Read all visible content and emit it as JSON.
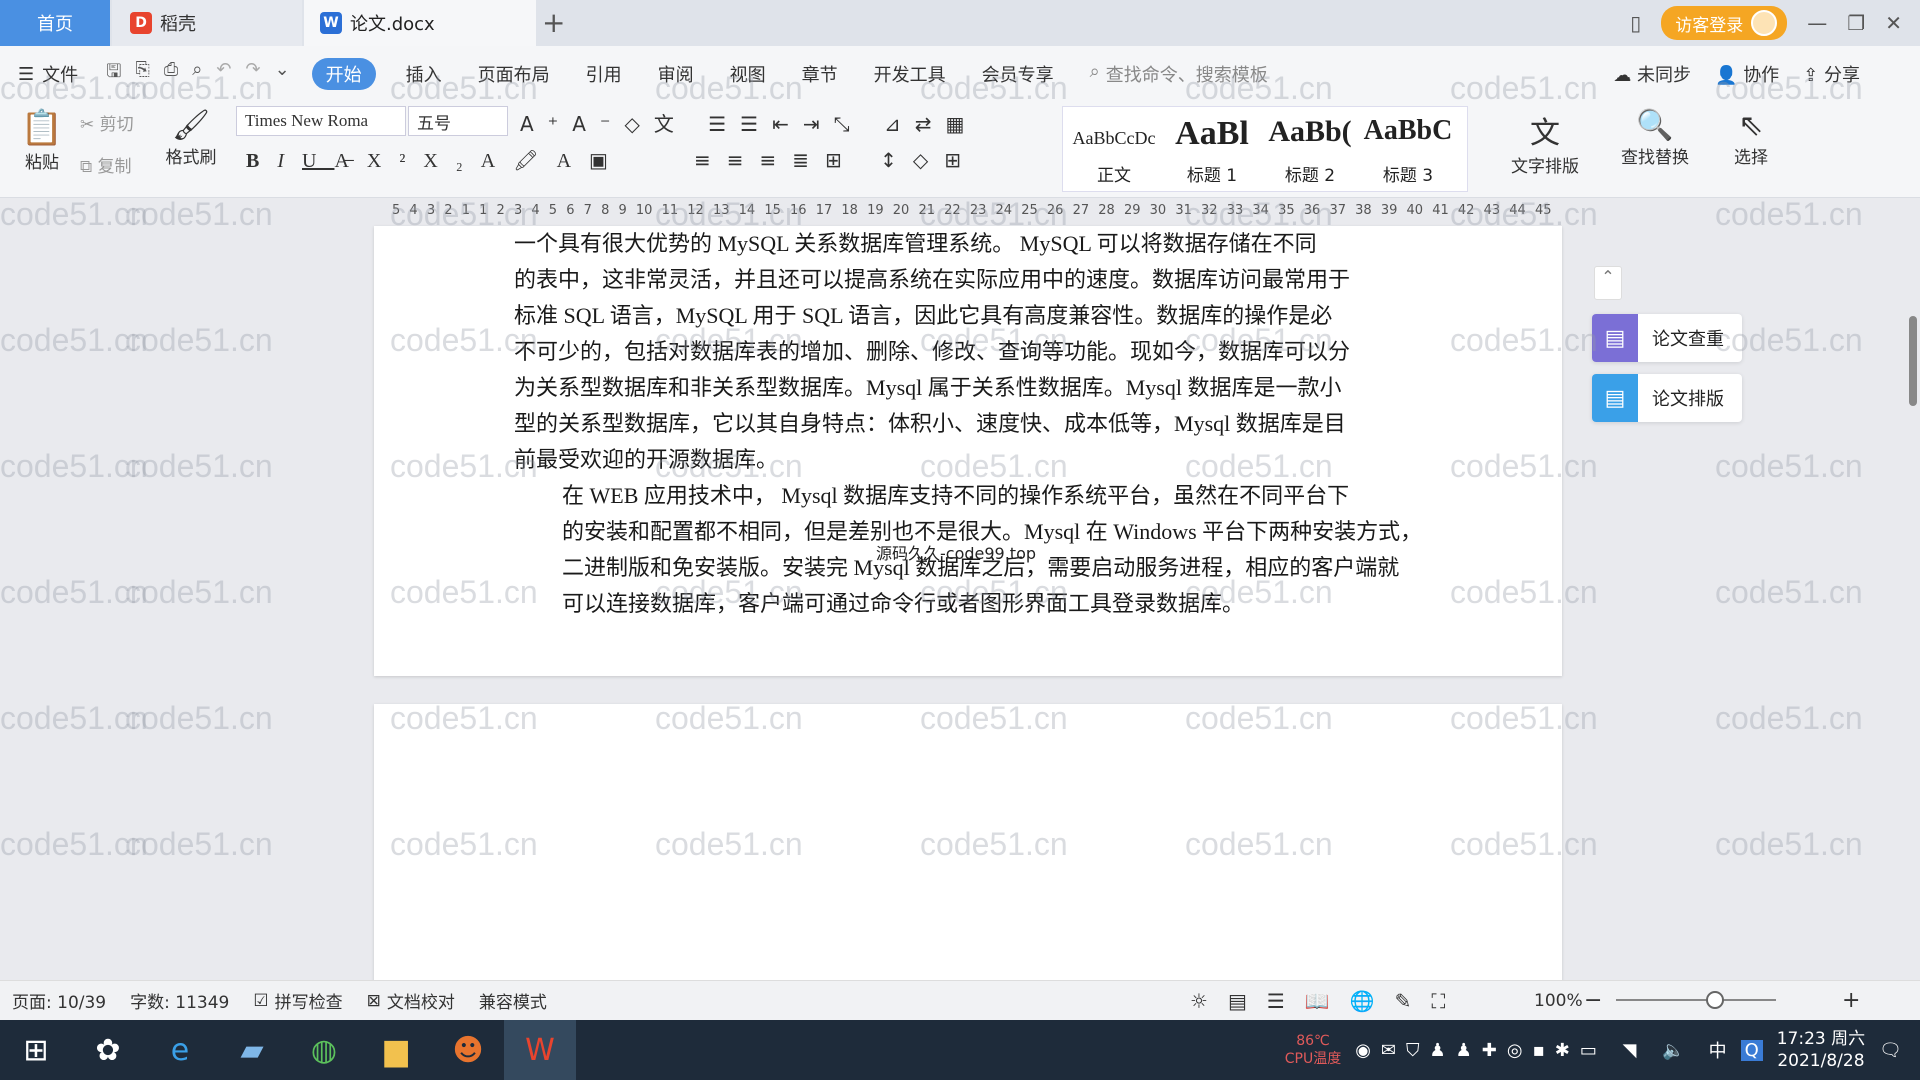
{
  "tabs": {
    "home": "首页",
    "daoke": "稻壳",
    "doc": "论文.docx",
    "new_tab": "+"
  },
  "header_right": {
    "login": "访客登录"
  },
  "menu": {
    "file": "文件",
    "items": [
      "开始",
      "插入",
      "页面布局",
      "引用",
      "审阅",
      "视图",
      "章节",
      "开发工具",
      "会员专享"
    ],
    "search_placeholder": "查找命令、搜索模板",
    "right": [
      "未同步",
      "协作",
      "分享"
    ]
  },
  "ribbon": {
    "paste": "粘贴",
    "cut": "剪切",
    "copy": "复制",
    "format_painter": "格式刷",
    "font_name": "Times New Roma",
    "font_size": "五号",
    "styles": [
      {
        "sample": "AaBbCcDc",
        "label": "正文"
      },
      {
        "sample": "AaBl",
        "label": "标题 1"
      },
      {
        "sample": "AaBb(",
        "label": "标题 2"
      },
      {
        "sample": "AaBbC",
        "label": "标题 3"
      }
    ],
    "text_layout": "文字排版",
    "find_replace": "查找替换",
    "select": "选择"
  },
  "ruler": {
    "numbers": [
      "5",
      "4",
      "3",
      "2",
      "1",
      "1",
      "2",
      "3",
      "4",
      "5",
      "6",
      "7",
      "8",
      "9",
      "10",
      "11",
      "12",
      "13",
      "14",
      "15",
      "16",
      "17",
      "18",
      "19",
      "20",
      "21",
      "22",
      "23",
      "24",
      "25",
      "26",
      "27",
      "28",
      "29",
      "30",
      "31",
      "32",
      "33",
      "34",
      "35",
      "36",
      "37",
      "38",
      "39",
      "40",
      "41",
      "42",
      "43",
      "44",
      "45"
    ]
  },
  "document": {
    "lines": [
      "一个具有很大优势的 MySQL 关系数据库管理系统。 MySQL 可以将数据存储在不同",
      "的表中，这非常灵活，并且还可以提高系统在实际应用中的速度。数据库访问最常用于",
      "标准 SQL 语言，MySQL 用于 SQL 语言，因此它具有高度兼容性。数据库的操作是必",
      "不可少的，包括对数据库表的增加、删除、修改、查询等功能。现如今，数据库可以分",
      "为关系型数据库和非关系型数据库。Mysql 属于关系性数据库。Mysql 数据库是一款小",
      "型的关系型数据库，它以其自身特点：体积小、速度快、成本低等，Mysql 数据库是目",
      "前最受欢迎的开源数据库。"
    ],
    "para2": [
      "在 WEB 应用技术中， Mysql 数据库支持不同的操作系统平台，虽然在不同平台下",
      "的安装和配置都不相同，但是差别也不是很大。Mysql 在 Windows 平台下两种安装方式，",
      "二进制版和免安装版。安装完 Mysql 数据库之后，需要启动服务进程，相应的客户端就",
      "可以连接数据库，客户端可通过命令行或者图形界面工具登录数据库。"
    ],
    "overlay": "源码久久-code99.top"
  },
  "side_panel": {
    "check": "论文查重",
    "layout": "论文排版"
  },
  "status": {
    "page": "页面: 10/39",
    "words": "字数: 11349",
    "spell": "拼写检查",
    "proof": "文档校对",
    "compat": "兼容模式",
    "zoom": "100%"
  },
  "taskbar": {
    "temp": "86℃",
    "temp_label": "CPU温度",
    "ime": "中",
    "time": "17:23 周六",
    "date": "2021/8/28"
  },
  "watermark": "code51.cn"
}
